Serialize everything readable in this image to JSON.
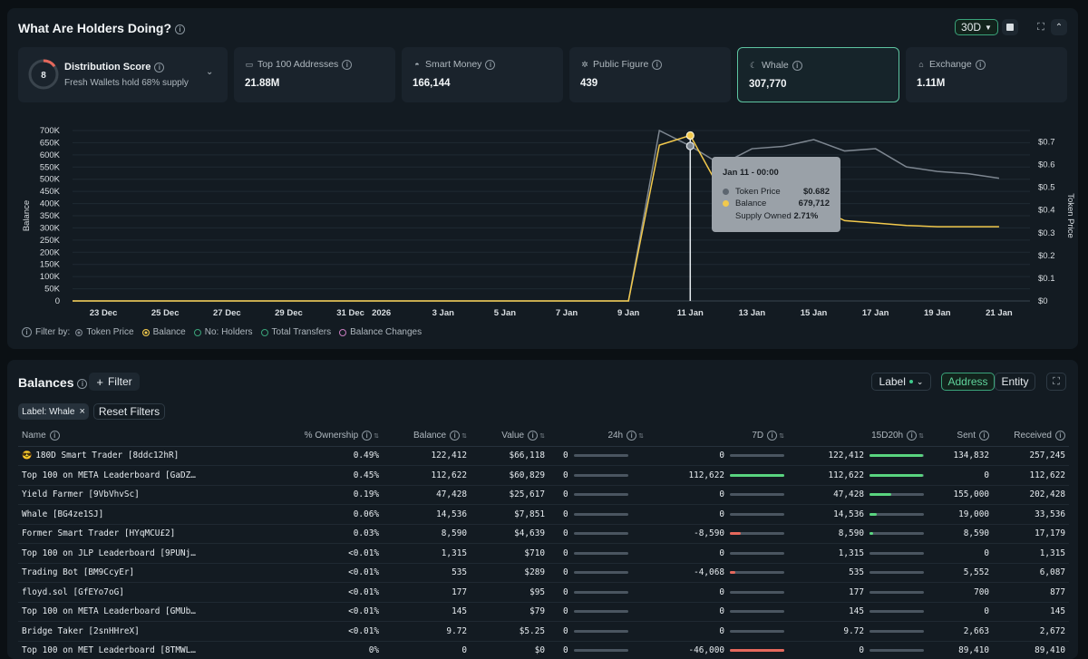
{
  "header": {
    "title": "What Are Holders Doing?",
    "range": "30D"
  },
  "distribution": {
    "score": "8",
    "title": "Distribution Score",
    "subtitle": "Fresh Wallets hold 68% supply"
  },
  "cards": [
    {
      "label": "Top 100 Addresses",
      "value": "21.88M",
      "icon": "wallet-icon"
    },
    {
      "label": "Smart Money",
      "value": "166,144",
      "icon": "smart-money-icon"
    },
    {
      "label": "Public Figure",
      "value": "439",
      "icon": "public-figure-icon"
    },
    {
      "label": "Whale",
      "value": "307,770",
      "icon": "whale-icon"
    },
    {
      "label": "Exchange",
      "value": "1.11M",
      "icon": "exchange-icon"
    }
  ],
  "chart_data": {
    "type": "line",
    "ylabel": "Balance",
    "y2label": "Token Price",
    "y_ticks": [
      "700K",
      "650K",
      "600K",
      "550K",
      "500K",
      "450K",
      "400K",
      "350K",
      "300K",
      "250K",
      "200K",
      "150K",
      "100K",
      "50K",
      "0"
    ],
    "y2_ticks": [
      "$0.7",
      "$0.6",
      "$0.5",
      "$0.4",
      "$0.3",
      "$0.2",
      "$0.1",
      "$0"
    ],
    "x_ticks": [
      "23 Dec",
      "25 Dec",
      "27 Dec",
      "29 Dec",
      "31 Dec",
      "2026",
      "3 Jan",
      "5 Jan",
      "7 Jan",
      "9 Jan",
      "11 Jan",
      "13 Jan",
      "15 Jan",
      "17 Jan",
      "19 Jan",
      "21 Jan"
    ],
    "ylim": [
      0,
      700000
    ],
    "y2lim": [
      0,
      0.75
    ],
    "series": [
      {
        "name": "Token Price",
        "color": "#7d8690",
        "axis": "right",
        "points": [
          [
            "2025-12-22",
            0
          ],
          [
            "2026-01-09",
            0
          ],
          [
            "2026-01-10",
            0.75
          ],
          [
            "2026-01-11",
            0.682
          ],
          [
            "2026-01-12",
            0.6
          ],
          [
            "2026-01-13",
            0.67
          ],
          [
            "2026-01-14",
            0.68
          ],
          [
            "2026-01-15",
            0.71
          ],
          [
            "2026-01-16",
            0.66
          ],
          [
            "2026-01-17",
            0.67
          ],
          [
            "2026-01-18",
            0.59
          ],
          [
            "2026-01-19",
            0.57
          ],
          [
            "2026-01-20",
            0.56
          ],
          [
            "2026-01-21",
            0.54
          ]
        ]
      },
      {
        "name": "Balance",
        "color": "#f2c94c",
        "axis": "left",
        "points": [
          [
            "2025-12-22",
            0
          ],
          [
            "2026-01-09",
            0
          ],
          [
            "2026-01-10",
            640000
          ],
          [
            "2026-01-11",
            679712
          ],
          [
            "2026-01-12",
            450000
          ],
          [
            "2026-01-13",
            410000
          ],
          [
            "2026-01-14",
            400000
          ],
          [
            "2026-01-15",
            390000
          ],
          [
            "2026-01-16",
            330000
          ],
          [
            "2026-01-17",
            320000
          ],
          [
            "2026-01-18",
            310000
          ],
          [
            "2026-01-19",
            305000
          ],
          [
            "2026-01-20",
            305000
          ],
          [
            "2026-01-21",
            305000
          ]
        ]
      }
    ],
    "tooltip": {
      "title": "Jan 11 - 00:00",
      "price_label": "Token Price",
      "price_value": "$0.682",
      "balance_label": "Balance",
      "balance_value": "679,712",
      "supply_label": "Supply Owned",
      "supply_value": "2.71%"
    }
  },
  "filters": {
    "label": "Filter by:",
    "items": [
      {
        "name": "Token Price",
        "color": "#7d8690",
        "filled": true
      },
      {
        "name": "Balance",
        "color": "#f2c94c",
        "filled": true
      },
      {
        "name": "No: Holders",
        "color": "#3aa37a",
        "filled": false
      },
      {
        "name": "Total Transfers",
        "color": "#3aa37a",
        "filled": false
      },
      {
        "name": "Balance Changes",
        "color": "#c87dc0",
        "filled": false
      }
    ]
  },
  "balances": {
    "title": "Balances",
    "filter_btn": "Filter",
    "label_select": "Label",
    "address_tab": "Address",
    "entity_tab": "Entity",
    "chip": "Label: Whale",
    "reset": "Reset Filters",
    "columns": [
      "Name",
      "% Ownership",
      "Balance",
      "Value",
      "24h",
      "7D",
      "15D20h",
      "Sent",
      "Received"
    ],
    "rows": [
      {
        "name": "180D Smart Trader [8ddc12hR]",
        "own": "0.49%",
        "bal": "122,412",
        "val": "$66,118",
        "d24": "0",
        "d7": "0",
        "d7f": 0,
        "d7c": "",
        "d15": "122,412",
        "d15f": 0.98,
        "sent": "134,832",
        "recv": "257,245"
      },
      {
        "name": "Top 100 on META Leaderboard [GaDZ…",
        "own": "0.45%",
        "bal": "112,622",
        "val": "$60,829",
        "d24": "0",
        "d7": "112,622",
        "d7f": 1.0,
        "d7c": "#59d47f",
        "d15": "112,622",
        "d15f": 0.98,
        "sent": "0",
        "recv": "112,622"
      },
      {
        "name": "Yield Farmer [9VbVhvSc]",
        "own": "0.19%",
        "bal": "47,428",
        "val": "$25,617",
        "d24": "0",
        "d7": "0",
        "d7f": 0,
        "d7c": "",
        "d15": "47,428",
        "d15f": 0.4,
        "sent": "155,000",
        "recv": "202,428"
      },
      {
        "name": "Whale [BG4ze1SJ]",
        "own": "0.06%",
        "bal": "14,536",
        "val": "$7,851",
        "d24": "0",
        "d7": "0",
        "d7f": 0,
        "d7c": "",
        "d15": "14,536",
        "d15f": 0.13,
        "sent": "19,000",
        "recv": "33,536"
      },
      {
        "name": "Former Smart Trader [HYqMCU£2]",
        "own": "0.03%",
        "bal": "8,590",
        "val": "$4,639",
        "d24": "0",
        "d7": "-8,590",
        "d7f": 0.2,
        "d7c": "#e5685c",
        "d15": "8,590",
        "d15f": 0.06,
        "sent": "8,590",
        "recv": "17,179"
      },
      {
        "name": "Top 100 on JLP Leaderboard [9PUNj…",
        "own": "<0.01%",
        "bal": "1,315",
        "val": "$710",
        "d24": "0",
        "d7": "0",
        "d7f": 0,
        "d7c": "",
        "d15": "1,315",
        "d15f": 0,
        "sent": "0",
        "recv": "1,315"
      },
      {
        "name": "Trading Bot [BM9CcyEr]",
        "own": "<0.01%",
        "bal": "535",
        "val": "$289",
        "d24": "0",
        "d7": "-4,068",
        "d7f": 0.1,
        "d7c": "#e5685c",
        "d15": "535",
        "d15f": 0,
        "sent": "5,552",
        "recv": "6,087"
      },
      {
        "name": "floyd.sol [GfEYo7oG]",
        "own": "<0.01%",
        "bal": "177",
        "val": "$95",
        "d24": "0",
        "d7": "0",
        "d7f": 0,
        "d7c": "",
        "d15": "177",
        "d15f": 0,
        "sent": "700",
        "recv": "877"
      },
      {
        "name": "Top 100 on META Leaderboard [GMUb…",
        "own": "<0.01%",
        "bal": "145",
        "val": "$79",
        "d24": "0",
        "d7": "0",
        "d7f": 0,
        "d7c": "",
        "d15": "145",
        "d15f": 0,
        "sent": "0",
        "recv": "145"
      },
      {
        "name": "Bridge Taker [2snHHreX]",
        "own": "<0.01%",
        "bal": "9.72",
        "val": "$5.25",
        "d24": "0",
        "d7": "0",
        "d7f": 0,
        "d7c": "",
        "d15": "9.72",
        "d15f": 0,
        "sent": "2,663",
        "recv": "2,672"
      },
      {
        "name": "Top 100 on MET Leaderboard [8TMWL…",
        "own": "0%",
        "bal": "0",
        "val": "$0",
        "d24": "0",
        "d7": "-46,000",
        "d7f": 1.0,
        "d7c": "#e5685c",
        "d15": "0",
        "d15f": 0,
        "sent": "89,410",
        "recv": "89,410"
      }
    ]
  }
}
